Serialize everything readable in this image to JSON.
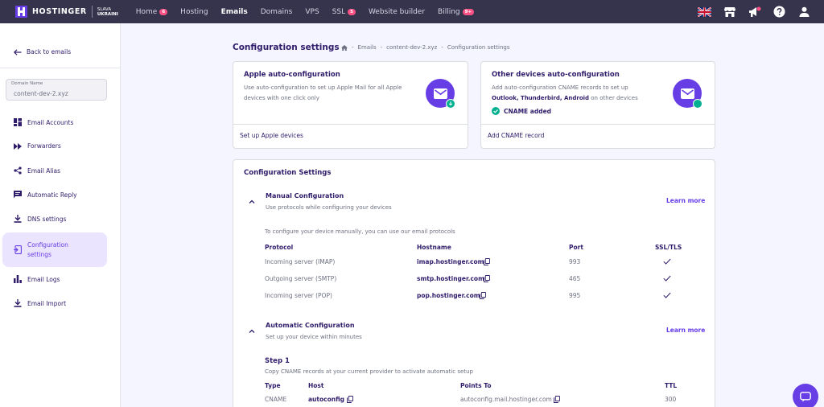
{
  "topnav": {
    "brand": "HOSTINGER",
    "brand_sub_1": "SLAVA",
    "brand_sub_2": "UKRAINI",
    "items": [
      {
        "label": "Home",
        "badge": "6"
      },
      {
        "label": "Hosting"
      },
      {
        "label": "Emails",
        "active": true
      },
      {
        "label": "Domains"
      },
      {
        "label": "VPS"
      },
      {
        "label": "SSL",
        "badge": "5"
      },
      {
        "label": "Website builder"
      },
      {
        "label": "Billing",
        "badge": "9+"
      }
    ],
    "right_icons": [
      "uk-flag-icon",
      "store-icon",
      "notification-icon",
      "help-icon",
      "user-icon"
    ]
  },
  "sidebar": {
    "back_label": "Back to emails",
    "domain_label": "Domain Name",
    "domain_value": "content-dev-2.xyz",
    "items": [
      {
        "label": "Email Accounts",
        "icon": "grid-icon"
      },
      {
        "label": "Forwarders",
        "icon": "fast-forward-icon"
      },
      {
        "label": "Email Alias",
        "icon": "share-icon"
      },
      {
        "label": "Automatic Reply",
        "icon": "reply-icon"
      },
      {
        "label": "DNS settings",
        "icon": "download-icon"
      },
      {
        "label": "Configuration",
        "label2": "settings",
        "icon": "config-icon",
        "active": true
      },
      {
        "label": "Email Logs",
        "icon": "bar-chart-icon"
      },
      {
        "label": "Email Import",
        "icon": "import-icon"
      }
    ]
  },
  "main": {
    "title": "Configuration settings",
    "breadcrumb": [
      "Emails",
      "content-dev-2.xyz",
      "Configuration settings"
    ],
    "apple_card": {
      "title": "Apple auto-configuration",
      "desc_1": "Use auto-configuration to set up Apple Mail for all Apple",
      "desc_2": "devices with one click only",
      "footer": "Set up Apple devices"
    },
    "other_card": {
      "title": "Other devices auto-configuration",
      "desc_1": "Add auto-configuration CNAME records to set up",
      "desc_2_bold": "Outlook, Thunderbird, Android",
      "desc_2_rest": " on other devices",
      "status": "CNAME added",
      "footer": "Add CNAME record"
    },
    "config": {
      "title": "Configuration Settings",
      "manual": {
        "title": "Manual Configuration",
        "subtitle": "Use protocols while configuring your devices",
        "learn_more": "Learn more",
        "intro": "To configure your device manually, you can use our email protocols",
        "headers": [
          "Protocol",
          "Hostname",
          "Port",
          "SSL/TLS"
        ],
        "rows": [
          {
            "protocol": "Incoming server (IMAP)",
            "hostname": "imap.hostinger.com",
            "port": "993"
          },
          {
            "protocol": "Outgoing server (SMTP)",
            "hostname": "smtp.hostinger.com",
            "port": "465"
          },
          {
            "protocol": "Incoming server (POP)",
            "hostname": "pop.hostinger.com",
            "port": "995"
          }
        ]
      },
      "automatic": {
        "title": "Automatic Configuration",
        "subtitle": "Set up your device within minutes",
        "learn_more": "Learn more",
        "step_title": "Step 1",
        "step_desc": "Copy CNAME records at your current provider to activate automatic setup",
        "headers": [
          "Type",
          "Host",
          "Points To",
          "TTL"
        ],
        "rows": [
          {
            "type": "CNAME",
            "host": "autoconfig",
            "points_to": "autoconfig.mail.hostinger.com",
            "ttl": "300"
          }
        ]
      }
    }
  },
  "colors": {
    "nav_bg": "#36344d",
    "brand": "#673de6",
    "badge": "#fc5185",
    "success": "#00b090",
    "page_bg": "#f4f5ff"
  }
}
